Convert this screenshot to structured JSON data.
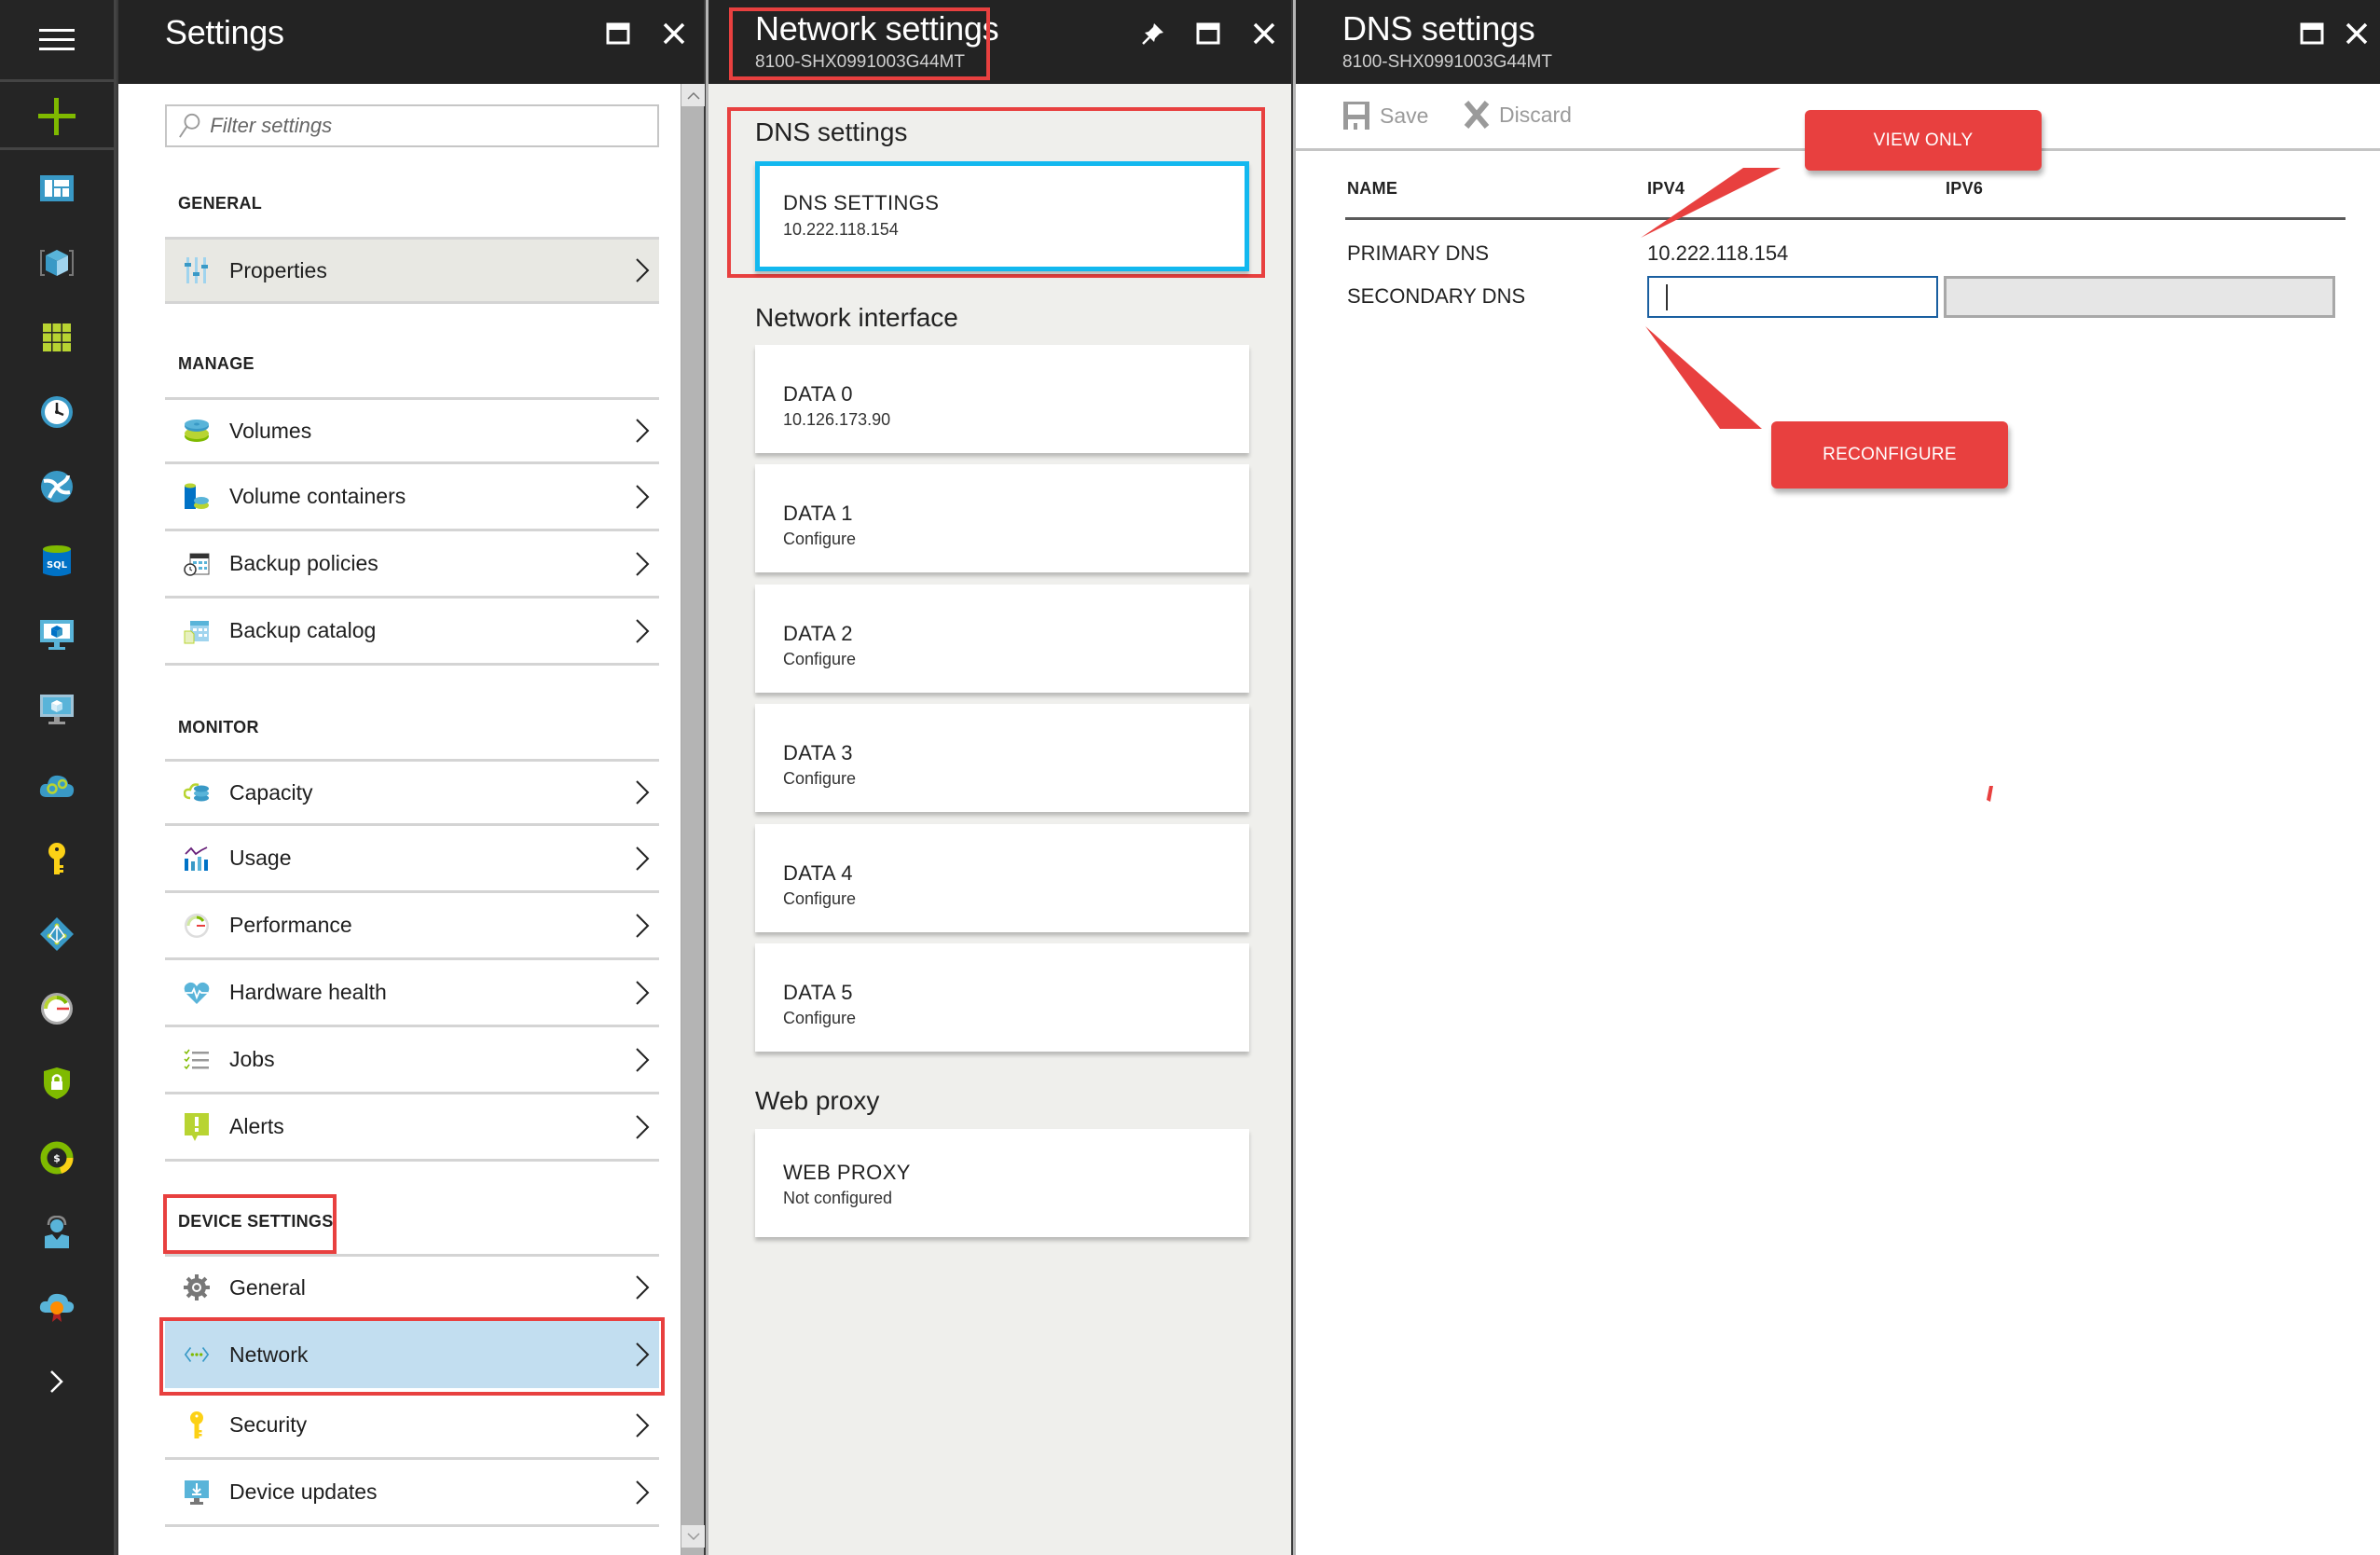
{
  "left_nav": {
    "menu_icon": "hamburger-icon",
    "new_icon": "plus-icon",
    "items": [
      {
        "name": "dashboard",
        "icon": "dashboard-icon"
      },
      {
        "name": "all-resources",
        "icon": "cube-icon"
      },
      {
        "name": "resource-groups",
        "icon": "grid-icon"
      },
      {
        "name": "recent",
        "icon": "clock-icon"
      },
      {
        "name": "app-services",
        "icon": "globe-icon"
      },
      {
        "name": "sql-databases",
        "icon": "sql-database-icon"
      },
      {
        "name": "virtual-machines",
        "icon": "virtual-machine-icon"
      },
      {
        "name": "virtual-machines-classic",
        "icon": "monitor-cube-icon"
      },
      {
        "name": "cloud-services",
        "icon": "cloud-gears-icon"
      },
      {
        "name": "key-vault",
        "icon": "key-icon"
      },
      {
        "name": "active-directory",
        "icon": "diamond-network-icon"
      },
      {
        "name": "monitor",
        "icon": "gauge-icon"
      },
      {
        "name": "security-center",
        "icon": "shield-lock-icon"
      },
      {
        "name": "billing",
        "icon": "cost-donut-icon"
      },
      {
        "name": "help-support",
        "icon": "support-person-icon"
      },
      {
        "name": "advisor",
        "icon": "cloud-badge-icon"
      }
    ],
    "expand_icon": "chevron-right-icon"
  },
  "settings_blade": {
    "title": "Settings",
    "filter_placeholder": "Filter settings",
    "sections": {
      "general": {
        "label": "GENERAL",
        "items": [
          {
            "label": "Properties",
            "icon": "sliders-icon"
          }
        ]
      },
      "manage": {
        "label": "MANAGE",
        "items": [
          {
            "label": "Volumes",
            "icon": "volumes-icon"
          },
          {
            "label": "Volume containers",
            "icon": "volume-containers-icon"
          },
          {
            "label": "Backup policies",
            "icon": "backup-policies-icon"
          },
          {
            "label": "Backup catalog",
            "icon": "backup-catalog-icon"
          }
        ]
      },
      "monitor": {
        "label": "MONITOR",
        "items": [
          {
            "label": "Capacity",
            "icon": "capacity-icon"
          },
          {
            "label": "Usage",
            "icon": "usage-chart-icon"
          },
          {
            "label": "Performance",
            "icon": "performance-gauge-icon"
          },
          {
            "label": "Hardware health",
            "icon": "heart-pulse-icon"
          },
          {
            "label": "Jobs",
            "icon": "checklist-icon"
          },
          {
            "label": "Alerts",
            "icon": "alert-icon"
          }
        ]
      },
      "device_settings": {
        "label": "DEVICE SETTINGS",
        "items": [
          {
            "label": "General",
            "icon": "gear-icon"
          },
          {
            "label": "Network",
            "icon": "network-icon",
            "selected": true
          },
          {
            "label": "Security",
            "icon": "key-icon"
          },
          {
            "label": "Device updates",
            "icon": "device-update-icon"
          }
        ]
      }
    }
  },
  "network_blade": {
    "title": "Network settings",
    "subtitle": "8100-SHX0991003G44MT",
    "dns_section": {
      "heading": "DNS settings",
      "tile": {
        "title": "DNS SETTINGS",
        "value": "10.222.118.154"
      }
    },
    "interface_section": {
      "heading": "Network interface",
      "tiles": [
        {
          "title": "DATA 0",
          "value": "10.126.173.90"
        },
        {
          "title": "DATA 1",
          "value": "Configure"
        },
        {
          "title": "DATA 2",
          "value": "Configure"
        },
        {
          "title": "DATA 3",
          "value": "Configure"
        },
        {
          "title": "DATA 4",
          "value": "Configure"
        },
        {
          "title": "DATA 5",
          "value": "Configure"
        }
      ]
    },
    "proxy_section": {
      "heading": "Web proxy",
      "tile": {
        "title": "WEB PROXY",
        "value": "Not configured"
      }
    }
  },
  "dns_blade": {
    "title": "DNS settings",
    "subtitle": "8100-SHX0991003G44MT",
    "toolbar": {
      "save_label": "Save",
      "discard_label": "Discard"
    },
    "table": {
      "headers": [
        "NAME",
        "IPV4",
        "IPV6"
      ],
      "rows": [
        {
          "name": "PRIMARY DNS",
          "ipv4": "10.222.118.154",
          "ipv6": ""
        },
        {
          "name": "SECONDARY DNS",
          "ipv4": "",
          "ipv6": ""
        }
      ]
    },
    "callouts": {
      "view_only": "VIEW ONLY",
      "reconfigure": "RECONFIGURE"
    }
  },
  "colors": {
    "annotation_red": "#e8403f",
    "selected_tile_border": "#12b8ef",
    "selected_row_bg": "#c2def0",
    "header_bg": "#232323",
    "azure_green": "#7fba00"
  }
}
